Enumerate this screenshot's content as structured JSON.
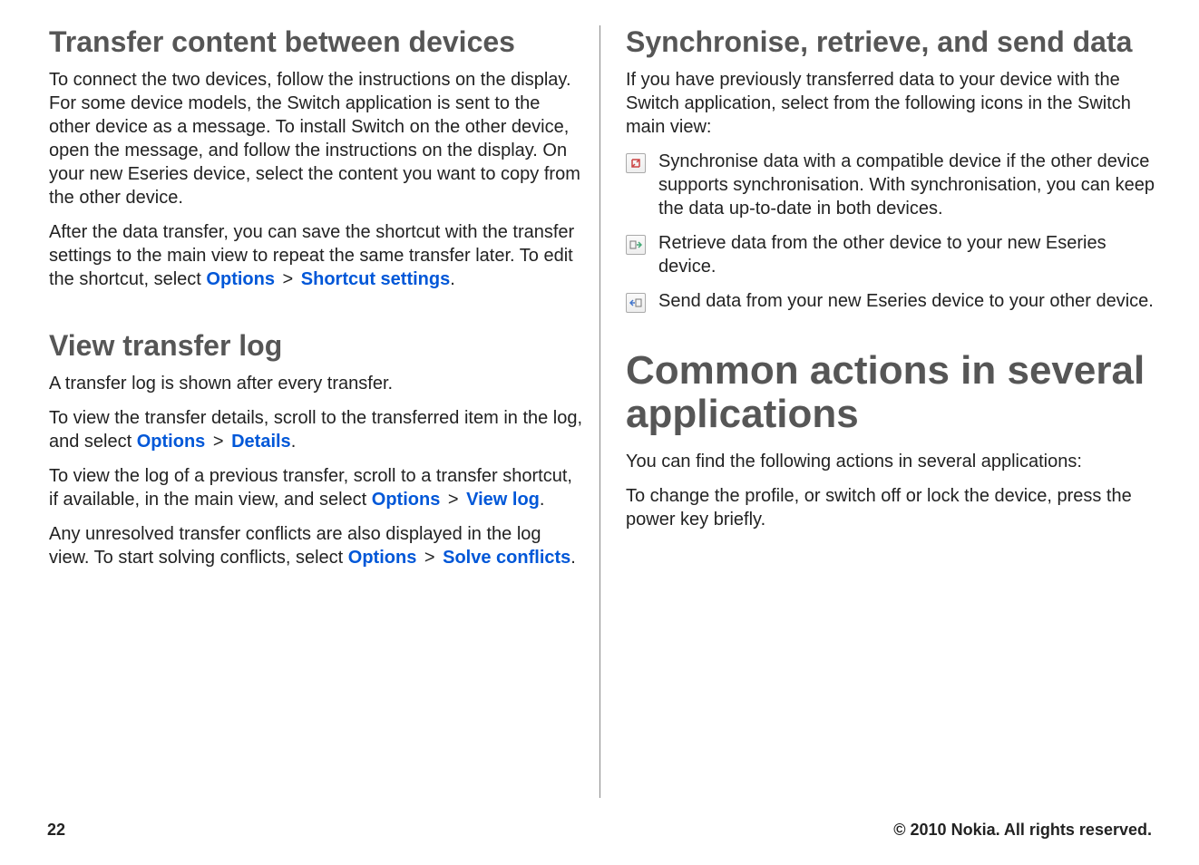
{
  "left": {
    "h2a": "Transfer content between devices",
    "p1": "To connect the two devices, follow the instructions on the display. For some device models, the Switch application is sent to the other device as a message. To install Switch on the other device, open the message, and follow the instructions on the display. On your new Eseries device, select the content you want to copy from the other device.",
    "p2_pre": "After the data transfer, you can save the shortcut with the transfer settings to the main view to repeat the same transfer later. To edit the shortcut, select ",
    "p2_m1": "Options",
    "p2_m2": "Shortcut settings",
    "h2b": "View transfer log",
    "p3": "A transfer log is shown after every transfer.",
    "p4_pre": "To view the transfer details, scroll to the transferred item in the log, and select ",
    "p4_m1": "Options",
    "p4_m2": "Details",
    "p5_pre": "To view the log of a previous transfer, scroll to a transfer shortcut, if available, in the main view, and select ",
    "p5_m1": "Options",
    "p5_m2": "View log",
    "p6_pre": "Any unresolved transfer conflicts are also displayed in the log view. To start solving conflicts, select ",
    "p6_m1": "Options",
    "p6_m2": "Solve conflicts"
  },
  "right": {
    "h2a": "Synchronise, retrieve, and send data",
    "p1": "If you have previously transferred data to your device with the Switch application, select from the following icons in the Switch main view:",
    "icon1": "Synchronise data with a compatible device if the other device supports synchronisation. With synchronisation, you can keep the data up-to-date in both devices.",
    "icon2": "Retrieve data from the other device to your new Eseries device.",
    "icon3": "Send data from your new Eseries device to your other device.",
    "h1": "Common actions in several applications",
    "p2": "You can find the following actions in several applications:",
    "p3": "To change the profile, or switch off or lock the device, press the power key briefly."
  },
  "footer": {
    "page": "22",
    "copyright": "© 2010 Nokia. All rights reserved."
  },
  "sep": ">"
}
